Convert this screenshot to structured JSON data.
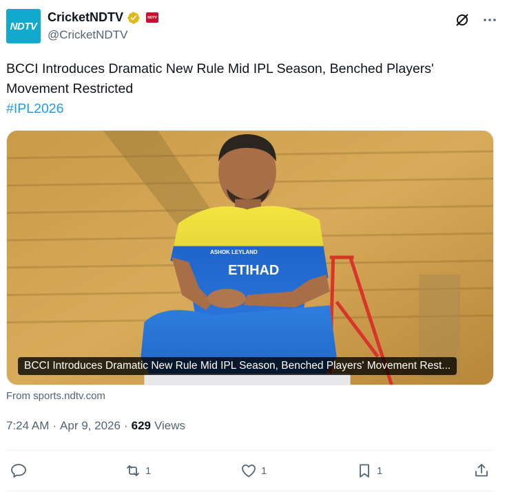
{
  "author": {
    "avatar_text": "NDTV",
    "display_name": "CricketNDTV",
    "handle": "@CricketNDTV",
    "affiliation_badge": "NDTV",
    "verified_color": "#e2b719"
  },
  "tweet": {
    "text": "BCCI Introduces Dramatic New Rule Mid IPL Season, Benched Players' Movement Restricted",
    "hashtag": "#IPL2026"
  },
  "card": {
    "caption": "BCCI Introduces Dramatic New Rule Mid IPL Season, Benched Players' Movement Rest...",
    "source": "From sports.ndtv.com",
    "jersey_front": "ETIHAD",
    "jersey_sponsor": "ASHOK LEYLAND"
  },
  "meta": {
    "time": "7:24 AM",
    "sep1": "·",
    "date": "Apr 9, 2026",
    "sep2": "·",
    "views_count": "629",
    "views_label": "Views"
  },
  "actions": {
    "reply_count": "",
    "repost_count": "1",
    "like_count": "1",
    "bookmark_count": "1"
  },
  "colors": {
    "link": "#1d9bf0",
    "secondary_text": "#536471",
    "primary_text": "#0f1419"
  }
}
